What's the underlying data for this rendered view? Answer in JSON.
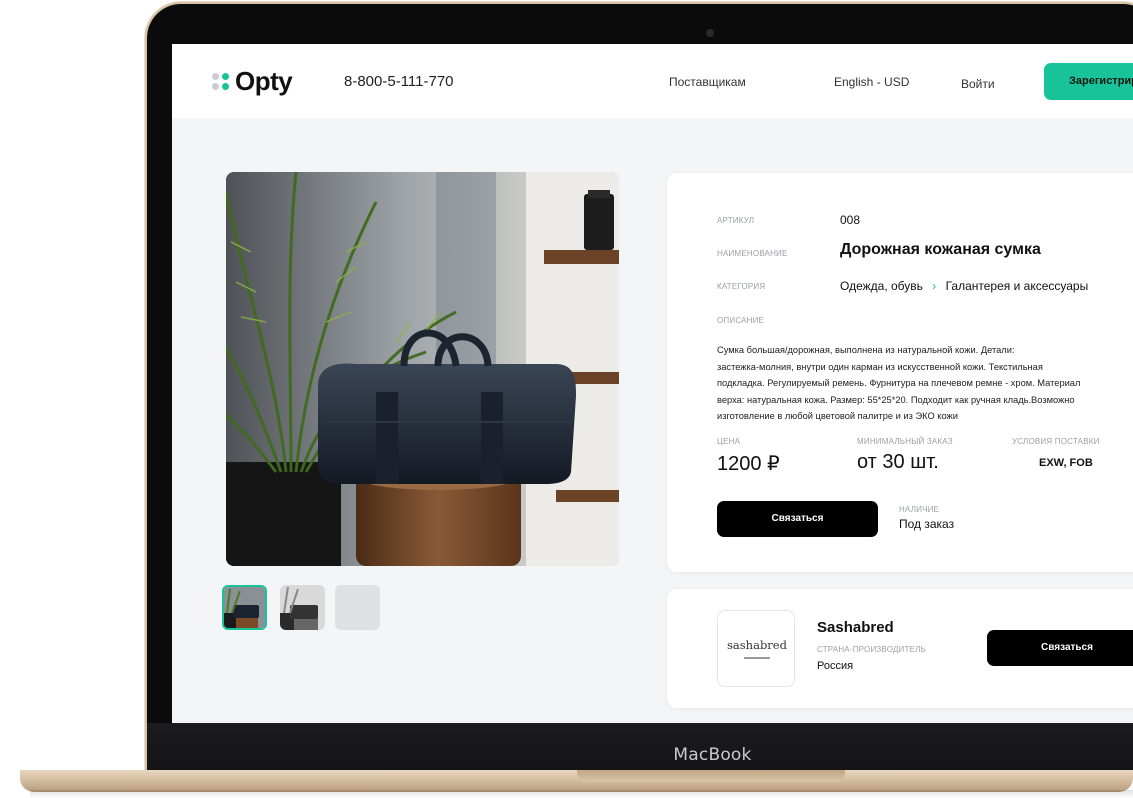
{
  "device": {
    "label": "MacBook"
  },
  "header": {
    "logo": "Opty",
    "phone": "8-800-5-111-770",
    "nav": [
      "Поставщикам",
      "English - USD",
      "Войти"
    ],
    "register_label": "Зарегистрироваться"
  },
  "product": {
    "article_label": "АРТИКУЛ",
    "article_value": "008",
    "name_label": "НАИМЕНОВАНИЕ",
    "name_value": "Дорожная кожаная сумка",
    "category_label": "КАТЕГОРИЯ",
    "category_parent": "Одежда, обувь",
    "category_child": "Галантерея и аксессуары",
    "description_label": "ОПИСАНИЕ",
    "description_lines": [
      "Сумка большая/дорожная, выполнена из натуральной кожи. Детали:",
      "застежка-молния, внутри один карман из искусственной кожи. Текстильная",
      "подкладка. Регулируемый ремень. Фурнитура на плечевом ремне - хром. Материал",
      "верха: натуральная кожа. Размер: 55*25*20. Подходит как ручная кладь.Возможно",
      "изготовление в любой цветовой палитре и из ЭКО кожи"
    ],
    "price_label": "ЦЕНА",
    "price_value": "1200 ₽",
    "min_order_label": "МИНИМАЛЬНЫЙ ЗАКАЗ",
    "min_order_value": "от 30 шт.",
    "delivery_label": "УСЛОВИЯ ПОСТАВКИ",
    "delivery_value": "EXW, FOB",
    "contact_label": "Связаться",
    "availability_label": "НАЛИЧИЕ",
    "availability_value": "Под заказ",
    "thumbnails": 3
  },
  "supplier": {
    "logo_text": "sashabred",
    "name": "Sashabred",
    "country_label": "СТРАНА-ПРОИЗВОДИТЕЛЬ",
    "country_value": "Россия",
    "contact_label": "Связаться"
  },
  "colors": {
    "accent": "#19c39a",
    "button": "#000000",
    "background": "#f4f5f7"
  }
}
